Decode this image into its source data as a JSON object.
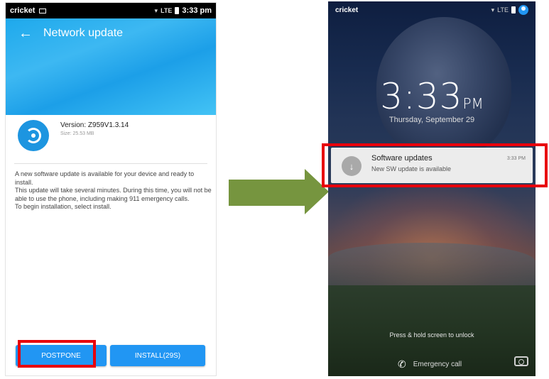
{
  "left_screen": {
    "status_bar": {
      "carrier": "cricket",
      "signal": "LTE",
      "time": "3:33 pm"
    },
    "header": {
      "title": "Network update"
    },
    "update": {
      "version": "Version: Z959V1.3.14",
      "size": "Size: 25.53 MB"
    },
    "description": [
      "A new software update is available for your device and ready to install.",
      "This update will take several minutes. During this time, you will not be able to use the phone, including making 911 emergency calls.",
      "To begin installation, select install."
    ],
    "buttons": {
      "postpone": "POSTPONE",
      "install": "INSTALL(29S)"
    },
    "colors": {
      "header": "#1ea9ec",
      "button": "#2196f3",
      "highlight": "#e8000b"
    }
  },
  "arrow": {
    "color": "#76953f"
  },
  "right_screen": {
    "status_bar": {
      "carrier": "cricket",
      "signal": "LTE"
    },
    "time": "3:33",
    "ampm": "PM",
    "date": "Thursday, September 29",
    "notification": {
      "title": "Software updates",
      "text": "New SW update is available",
      "time": "3:33 PM",
      "icon": "download-icon"
    },
    "unlock_hint": "Press & hold screen to unlock",
    "emergency": "Emergency call"
  }
}
